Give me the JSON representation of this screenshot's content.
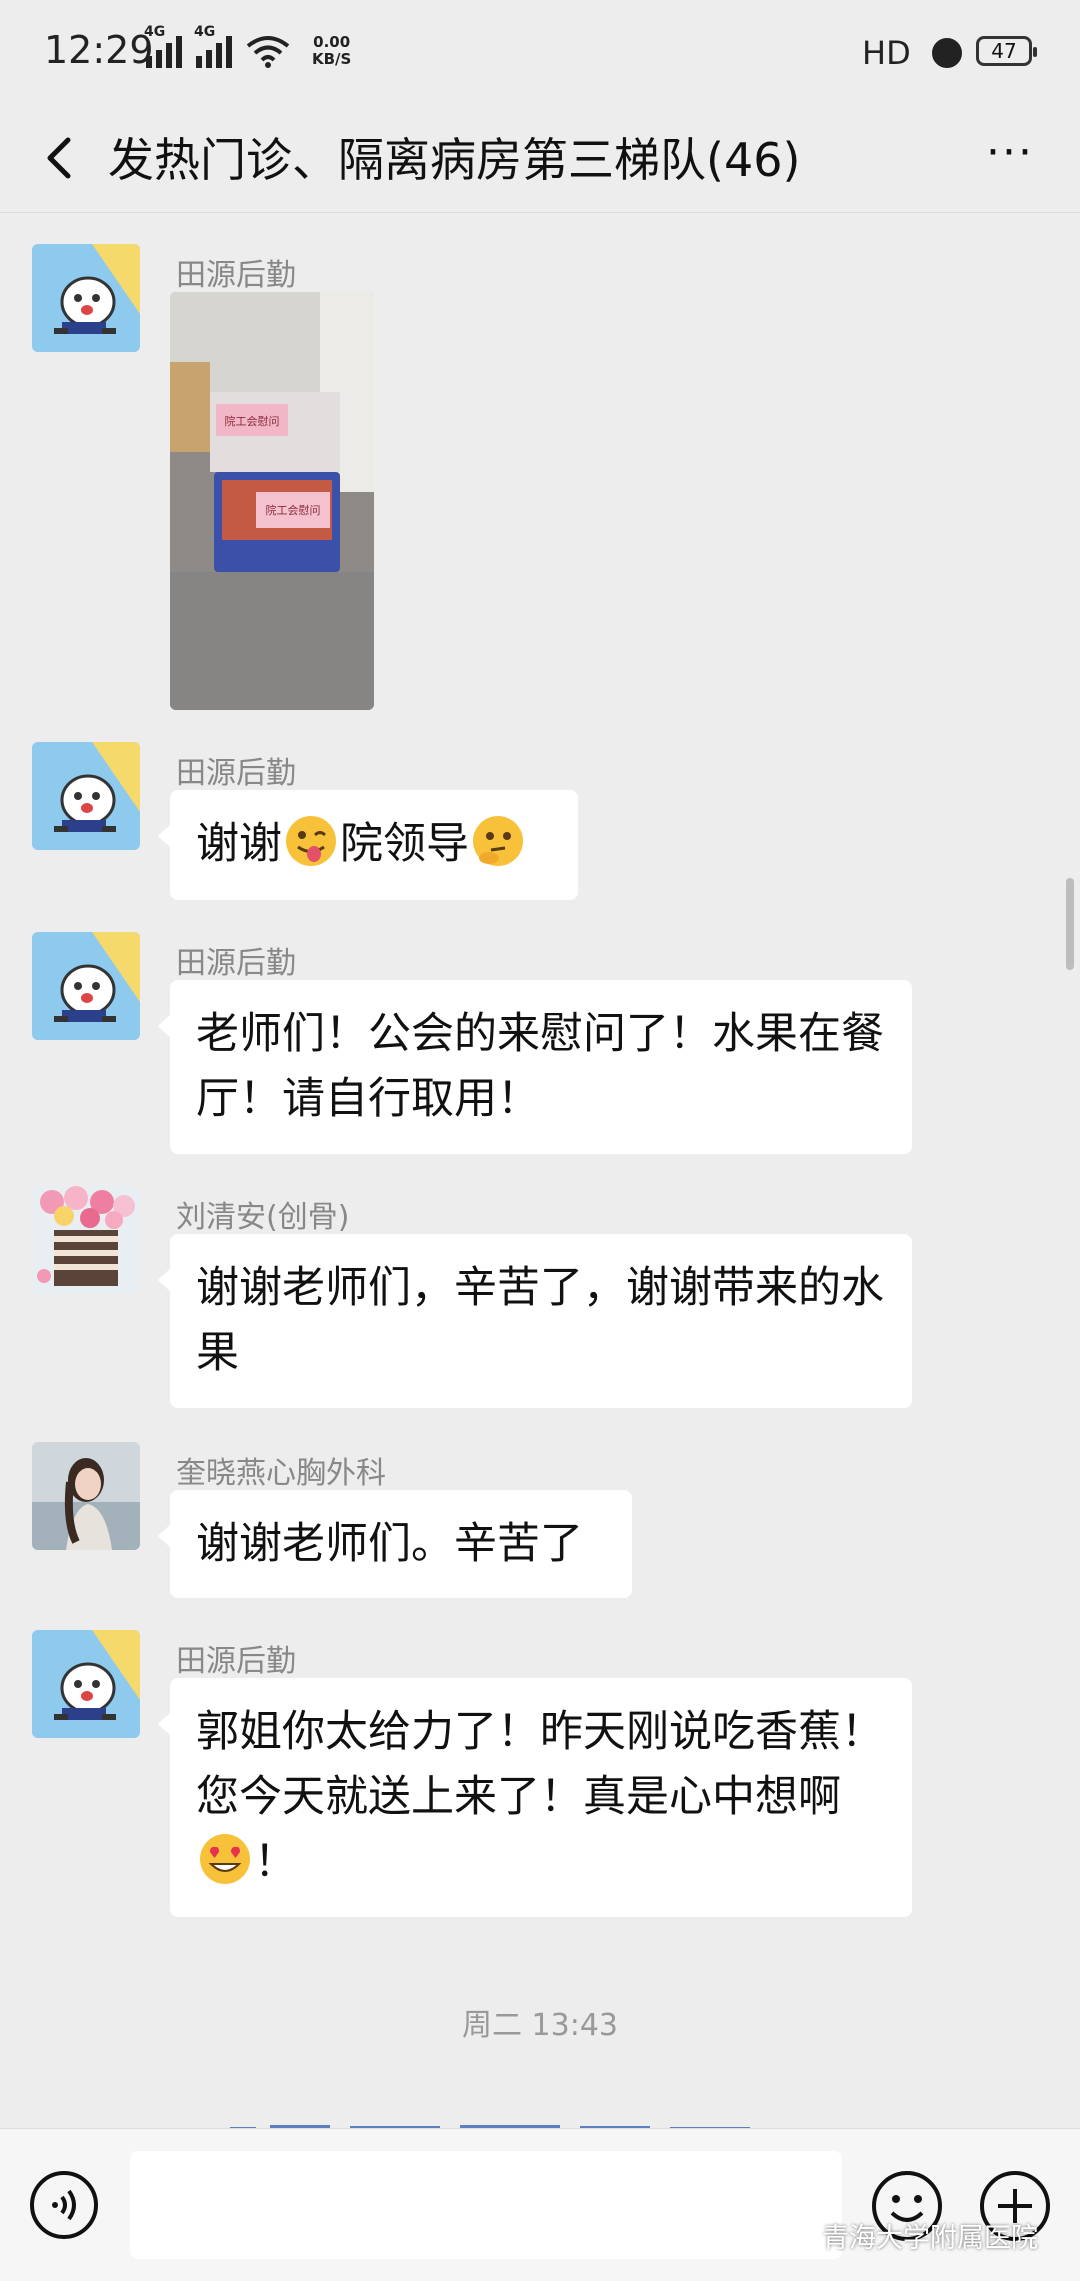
{
  "status_bar": {
    "time": "12:29",
    "network1": "4G",
    "network2": "4G",
    "speed_value": "0.00",
    "speed_unit": "KB/S",
    "hd": "HD",
    "battery": "47"
  },
  "header": {
    "title": "发热门诊、隔离病房第三梯队(46)",
    "more_label": "···"
  },
  "messages": [
    {
      "sender": "田源后勤",
      "type": "image"
    },
    {
      "sender": "田源后勤",
      "text_parts": [
        "谢谢",
        "院领导"
      ]
    },
    {
      "sender": "田源后勤",
      "text": "老师们！公会的来慰问了！水果在餐厅！请自行取用！"
    },
    {
      "sender": "刘清安(创骨)",
      "text": "谢谢老师们，辛苦了，谢谢带来的水果"
    },
    {
      "sender": "奎晓燕心胸外科",
      "text": "谢谢老师们。辛苦了"
    },
    {
      "sender": "田源后勤",
      "text_parts": [
        "郭姐你太给力了！昨天刚说吃香蕉！您今天就送上来了！真是心中想啊",
        "！"
      ]
    }
  ],
  "timestamp": "周二 13:43",
  "photo_labels": [
    "院工会慰问",
    "院工会慰问"
  ],
  "watermark": "青海大学附属医院",
  "icons": [
    "back-arrow-icon",
    "more-icon",
    "voice-icon",
    "emoji-icon",
    "plus-icon",
    "alarm-icon",
    "wifi-icon",
    "signal-icon",
    "battery-icon"
  ]
}
